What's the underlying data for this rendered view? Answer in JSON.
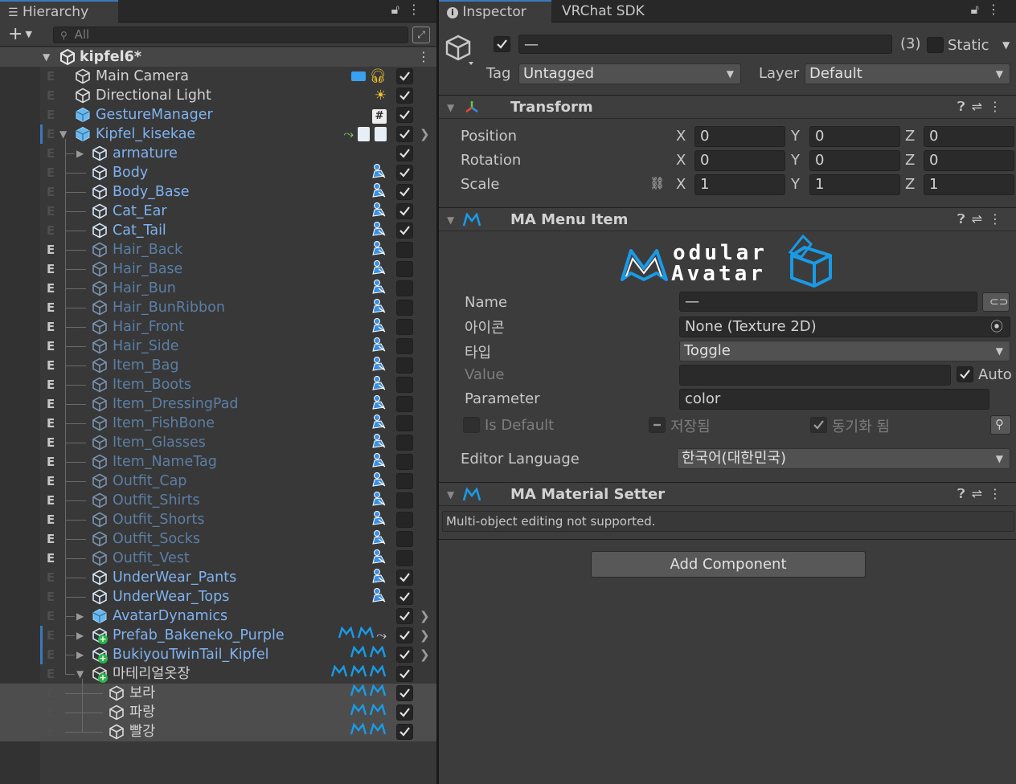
{
  "hierarchy": {
    "tab_label": "Hierarchy",
    "search_placeholder": "All",
    "scene_name": "kipfel6*",
    "rows": [
      {
        "name": "Main Camera",
        "flag": "E",
        "flagFaint": true,
        "indent": 0,
        "color": "white",
        "icons": "camera-audio",
        "checked": true
      },
      {
        "name": "Directional Light",
        "flag": "E",
        "flagFaint": true,
        "indent": 0,
        "color": "white",
        "icons": "light",
        "checked": true
      },
      {
        "name": "GestureManager",
        "flag": "E",
        "flagFaint": true,
        "indent": 0,
        "color": "blue",
        "icons": "script",
        "checked": true
      },
      {
        "name": "Kipfel_kisekae",
        "flag": "E",
        "flagFaint": true,
        "indent": 0,
        "color": "blue",
        "icons": "avatar",
        "checked": true,
        "expand": "open",
        "arrow": true,
        "edge": true
      },
      {
        "name": "armature",
        "flag": "E",
        "flagFaint": true,
        "indent": 1,
        "color": "blue",
        "icons": "",
        "checked": true,
        "expand": "closed"
      },
      {
        "name": "Body",
        "flag": "E",
        "flagFaint": true,
        "indent": 1,
        "color": "blue",
        "icons": "mesh",
        "checked": true
      },
      {
        "name": "Body_Base",
        "flag": "E",
        "flagFaint": true,
        "indent": 1,
        "color": "blue",
        "icons": "mesh",
        "checked": true
      },
      {
        "name": "Cat_Ear",
        "flag": "E",
        "flagFaint": true,
        "indent": 1,
        "color": "blue",
        "icons": "mesh",
        "checked": true
      },
      {
        "name": "Cat_Tail",
        "flag": "E",
        "flagFaint": true,
        "indent": 1,
        "color": "blue",
        "icons": "mesh",
        "checked": true
      },
      {
        "name": "Hair_Back",
        "flag": "E",
        "flagFaint": false,
        "indent": 1,
        "color": "dim",
        "icons": "mesh",
        "checked": false
      },
      {
        "name": "Hair_Base",
        "flag": "E",
        "flagFaint": false,
        "indent": 1,
        "color": "dim",
        "icons": "mesh",
        "checked": false
      },
      {
        "name": "Hair_Bun",
        "flag": "E",
        "flagFaint": false,
        "indent": 1,
        "color": "dim",
        "icons": "mesh",
        "checked": false
      },
      {
        "name": "Hair_BunRibbon",
        "flag": "E",
        "flagFaint": false,
        "indent": 1,
        "color": "dim",
        "icons": "mesh",
        "checked": false
      },
      {
        "name": "Hair_Front",
        "flag": "E",
        "flagFaint": false,
        "indent": 1,
        "color": "dim",
        "icons": "mesh",
        "checked": false
      },
      {
        "name": "Hair_Side",
        "flag": "E",
        "flagFaint": false,
        "indent": 1,
        "color": "dim",
        "icons": "mesh",
        "checked": false
      },
      {
        "name": "Item_Bag",
        "flag": "E",
        "flagFaint": false,
        "indent": 1,
        "color": "dim",
        "icons": "mesh",
        "checked": false
      },
      {
        "name": "Item_Boots",
        "flag": "E",
        "flagFaint": false,
        "indent": 1,
        "color": "dim",
        "icons": "mesh",
        "checked": false
      },
      {
        "name": "Item_DressingPad",
        "flag": "E",
        "flagFaint": false,
        "indent": 1,
        "color": "dim",
        "icons": "mesh",
        "checked": false
      },
      {
        "name": "Item_FishBone",
        "flag": "E",
        "flagFaint": false,
        "indent": 1,
        "color": "dim",
        "icons": "mesh",
        "checked": false
      },
      {
        "name": "Item_Glasses",
        "flag": "E",
        "flagFaint": false,
        "indent": 1,
        "color": "dim",
        "icons": "mesh",
        "checked": false
      },
      {
        "name": "Item_NameTag",
        "flag": "E",
        "flagFaint": false,
        "indent": 1,
        "color": "dim",
        "icons": "mesh",
        "checked": false
      },
      {
        "name": "Outfit_Cap",
        "flag": "E",
        "flagFaint": false,
        "indent": 1,
        "color": "dim",
        "icons": "mesh",
        "checked": false
      },
      {
        "name": "Outfit_Shirts",
        "flag": "E",
        "flagFaint": false,
        "indent": 1,
        "color": "dim",
        "icons": "mesh",
        "checked": false
      },
      {
        "name": "Outfit_Shorts",
        "flag": "E",
        "flagFaint": false,
        "indent": 1,
        "color": "dim",
        "icons": "mesh",
        "checked": false
      },
      {
        "name": "Outfit_Socks",
        "flag": "E",
        "flagFaint": false,
        "indent": 1,
        "color": "dim",
        "icons": "mesh",
        "checked": false
      },
      {
        "name": "Outfit_Vest",
        "flag": "E",
        "flagFaint": false,
        "indent": 1,
        "color": "dim",
        "icons": "mesh",
        "checked": false
      },
      {
        "name": "UnderWear_Pants",
        "flag": "E",
        "flagFaint": true,
        "indent": 1,
        "color": "blue",
        "icons": "mesh",
        "checked": true
      },
      {
        "name": "UnderWear_Tops",
        "flag": "E",
        "flagFaint": true,
        "indent": 1,
        "color": "blue",
        "icons": "mesh",
        "checked": true
      },
      {
        "name": "AvatarDynamics",
        "flag": "E",
        "flagFaint": true,
        "indent": 1,
        "color": "blue",
        "icons": "",
        "checked": true,
        "expand": "closed",
        "arrow": true,
        "bluecube": true
      },
      {
        "name": "Prefab_Bakeneko_Purple",
        "flag": "E",
        "flagFaint": true,
        "indent": 1,
        "color": "blue",
        "icons": "ma2-bone",
        "checked": true,
        "expand": "closed",
        "arrow": true,
        "prefab": true,
        "edge": true
      },
      {
        "name": "BukiyouTwinTail_Kipfel",
        "flag": "E",
        "flagFaint": true,
        "indent": 1,
        "color": "blue",
        "icons": "ma2",
        "checked": true,
        "expand": "closed",
        "arrow": true,
        "prefab": true,
        "edge": true
      },
      {
        "name": "마테리얼옷장",
        "flag": "E",
        "flagFaint": true,
        "indent": 1,
        "color": "white",
        "icons": "ma3",
        "checked": true,
        "expand": "open",
        "prefab": true
      },
      {
        "name": "보라",
        "flag": "E",
        "flagFaint": true,
        "indent": 2,
        "color": "white",
        "icons": "ma2",
        "checked": true,
        "selected": true
      },
      {
        "name": "파랑",
        "flag": "E",
        "flagFaint": true,
        "indent": 2,
        "color": "white",
        "icons": "ma2",
        "checked": true,
        "selected": true
      },
      {
        "name": "빨강",
        "flag": "E",
        "flagFaint": true,
        "indent": 2,
        "color": "white",
        "icons": "ma2",
        "checked": true,
        "selected": true
      }
    ]
  },
  "inspector": {
    "tab_label": "Inspector",
    "tab2_label": "VRChat SDK",
    "name_value": "—",
    "count": "(3)",
    "static_label": "Static",
    "tag_label": "Tag",
    "tag_value": "Untagged",
    "layer_label": "Layer",
    "layer_value": "Default",
    "transform": {
      "title": "Transform",
      "rows": [
        {
          "label": "Position",
          "x": "0",
          "y": "0",
          "z": "0"
        },
        {
          "label": "Rotation",
          "x": "0",
          "y": "0",
          "z": "0"
        },
        {
          "label": "Scale",
          "x": "1",
          "y": "1",
          "z": "1"
        }
      ],
      "axis_x": "X",
      "axis_y": "Y",
      "axis_z": "Z"
    },
    "menu_item": {
      "title": "MA Menu Item",
      "logo_line1": "odular",
      "logo_line2": "Avatar",
      "name_label": "Name",
      "name_value": "—",
      "icon_label": "아이콘",
      "icon_value": "None (Texture 2D)",
      "type_label": "타입",
      "type_value": "Toggle",
      "value_label": "Value",
      "auto_label": "Auto",
      "parameter_label": "Parameter",
      "parameter_value": "color",
      "isdefault_label": "Is Default",
      "saved_label": "저장됨",
      "synced_label": "동기화 됨",
      "editor_lang_label": "Editor Language",
      "editor_lang_value": "한국어(대한민국)"
    },
    "material_setter": {
      "title": "MA Material Setter",
      "message": "Multi-object editing not supported."
    },
    "add_component": "Add Component"
  },
  "colors": {
    "accent": "#3a79bb",
    "blue_text": "#7fb2f0",
    "ma_blue": "#1a9ae6"
  }
}
